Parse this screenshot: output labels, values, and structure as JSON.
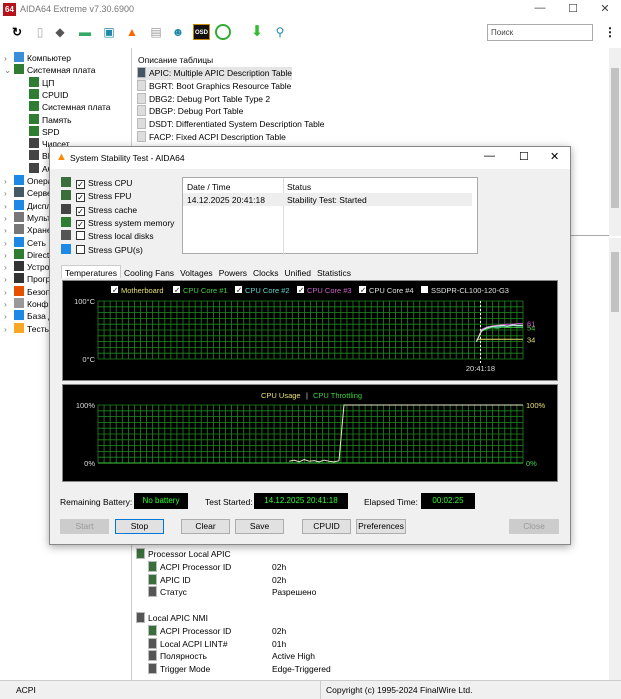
{
  "app": {
    "title": "AIDA64 Extreme v7.30.6900",
    "logo": "64"
  },
  "toolbar": {
    "search_placeholder": "Поиск",
    "icons": [
      "refresh-icon",
      "report-icon",
      "motherboard-icon",
      "memory-icon",
      "network-icon",
      "flame-icon",
      "tools-icon",
      "user-icon",
      "osd-icon",
      "gauge-icon",
      "download-icon",
      "search-icon"
    ],
    "osd": "OSD"
  },
  "tree": [
    {
      "label": "Компьютер",
      "level": 0,
      "expander": ">"
    },
    {
      "label": "Системная плата",
      "level": 0,
      "expander": "v"
    },
    {
      "label": "ЦП",
      "level": 1
    },
    {
      "label": "CPUID",
      "level": 1
    },
    {
      "label": "Системная плата",
      "level": 1
    },
    {
      "label": "Память",
      "level": 1
    },
    {
      "label": "SPD",
      "level": 1
    },
    {
      "label": "Чипсет",
      "level": 1
    },
    {
      "label": "BIOS",
      "level": 1
    },
    {
      "label": "ACPI",
      "level": 1
    },
    {
      "label": "Операционная система",
      "level": 0,
      "expander": ">"
    },
    {
      "label": "Сервер",
      "level": 0,
      "expander": ">"
    },
    {
      "label": "Дисплей",
      "level": 0,
      "expander": ">"
    },
    {
      "label": "Мультимедиа",
      "level": 0,
      "expander": ">"
    },
    {
      "label": "Хранение данных",
      "level": 0,
      "expander": ">"
    },
    {
      "label": "Сеть",
      "level": 0,
      "expander": ">"
    },
    {
      "label": "DirectX",
      "level": 0,
      "expander": ">"
    },
    {
      "label": "Устройства",
      "level": 0,
      "expander": ">"
    },
    {
      "label": "Программы",
      "level": 0,
      "expander": ">"
    },
    {
      "label": "Безопасность",
      "level": 0,
      "expander": ">"
    },
    {
      "label": "Конфигурация",
      "level": 0,
      "expander": ">"
    },
    {
      "label": "База данных",
      "level": 0,
      "expander": ">"
    },
    {
      "label": "Тесты",
      "level": 0,
      "expander": ">"
    }
  ],
  "acpi_tables": {
    "header": "Описание таблицы",
    "rows": [
      "APIC: Multiple APIC Description Table",
      "BGRT: Boot Graphics Resource Table",
      "DBG2: Debug Port Table Type 2",
      "DBGP: Debug Port Table",
      "DSDT: Differentiated System Description Table",
      "FACP: Fixed ACPI Description Table"
    ]
  },
  "details": [
    {
      "label": "Processor Local APIC",
      "value": "",
      "indent": 0
    },
    {
      "label": "ACPI Processor ID",
      "value": "02h",
      "indent": 1
    },
    {
      "label": "APIC ID",
      "value": "02h",
      "indent": 1
    },
    {
      "label": "Статус",
      "value": "Разрешено",
      "indent": 1
    },
    {
      "label": "",
      "value": "",
      "indent": 0
    },
    {
      "label": "Local APIC NMI",
      "value": "",
      "indent": 0
    },
    {
      "label": "ACPI Processor ID",
      "value": "02h",
      "indent": 1
    },
    {
      "label": "Local ACPI LINT#",
      "value": "01h",
      "indent": 1
    },
    {
      "label": "Полярность",
      "value": "Active High",
      "indent": 1
    },
    {
      "label": "Trigger Mode",
      "value": "Edge-Triggered",
      "indent": 1
    }
  ],
  "status": {
    "left": "ACPI",
    "right": "Copyright (c) 1995-2024 FinalWire Ltd."
  },
  "dialog": {
    "title": "System Stability Test - AIDA64",
    "stress": [
      {
        "label": "Stress CPU",
        "checked": true
      },
      {
        "label": "Stress FPU",
        "checked": true
      },
      {
        "label": "Stress cache",
        "checked": true
      },
      {
        "label": "Stress system memory",
        "checked": true
      },
      {
        "label": "Stress local disks",
        "checked": false
      },
      {
        "label": "Stress GPU(s)",
        "checked": false
      }
    ],
    "log": {
      "headers": [
        "Date / Time",
        "Status"
      ],
      "rows": [
        [
          "14.12.2025 20:41:18",
          "Stability Test: Started"
        ]
      ]
    },
    "tabs": [
      "Temperatures",
      "Cooling Fans",
      "Voltages",
      "Powers",
      "Clocks",
      "Unified",
      "Statistics"
    ],
    "active_tab": "Temperatures",
    "battery_label": "Remaining Battery:",
    "battery_value": "No battery",
    "started_label": "Test Started:",
    "started_value": "14.12.2025 20:41:18",
    "elapsed_label": "Elapsed Time:",
    "elapsed_value": "00:02:25",
    "buttons": {
      "start": "Start",
      "stop": "Stop",
      "clear": "Clear",
      "save": "Save",
      "cpuid": "CPUID",
      "preferences": "Preferences",
      "close": "Close"
    }
  },
  "chart_data": [
    {
      "type": "line",
      "title": "Temperatures",
      "ylim": [
        0,
        100
      ],
      "ytick_top": "100°C",
      "ytick_bottom": "0°C",
      "xtick": "20:41:18",
      "legend": [
        {
          "name": "Motherboard",
          "color": "#e8e070",
          "checked": true
        },
        {
          "name": "CPU Core #1",
          "color": "#40d040",
          "checked": true
        },
        {
          "name": "CPU Core #2",
          "color": "#60d0d0",
          "checked": true
        },
        {
          "name": "CPU Core #3",
          "color": "#d060d0",
          "checked": true
        },
        {
          "name": "CPU Core #4",
          "color": "#e0e0e0",
          "checked": true
        },
        {
          "name": "SSDPR-CL100-120-G3",
          "color": "#e0e0e0",
          "checked": false
        }
      ],
      "series": [
        {
          "name": "Motherboard",
          "values": [
            34,
            34,
            34,
            34,
            34,
            34,
            34,
            34,
            34,
            34
          ],
          "end_label": "34"
        },
        {
          "name": "CPU Core #1",
          "values": [
            30,
            48,
            52,
            54,
            53,
            55,
            54,
            55,
            54,
            54
          ],
          "end_label": "54"
        },
        {
          "name": "CPU Core #2",
          "values": [
            30,
            50,
            53,
            56,
            55,
            57,
            56,
            58,
            57,
            57
          ]
        },
        {
          "name": "CPU Core #3",
          "values": [
            30,
            51,
            55,
            57,
            58,
            59,
            60,
            60,
            61,
            61
          ],
          "end_label": "61"
        },
        {
          "name": "CPU Core #4",
          "values": [
            30,
            49,
            54,
            56,
            57,
            58,
            57,
            59,
            58,
            58
          ]
        }
      ]
    },
    {
      "type": "line",
      "title": "CPU Usage | CPU Throttling",
      "legend": [
        {
          "name": "CPU Usage",
          "color": "#e8e070"
        },
        {
          "name": "CPU Throttling",
          "color": "#40d040"
        }
      ],
      "ylim": [
        0,
        100
      ],
      "ytick_top": "100%",
      "ytick_bottom": "0%",
      "right_top": "100%",
      "right_bottom": "0%",
      "series": [
        {
          "name": "CPU Usage",
          "x_start_fraction": 0.45,
          "values": [
            3,
            5,
            2,
            6,
            3,
            4,
            2,
            5,
            3,
            2,
            4,
            100,
            100,
            100,
            100,
            100,
            100,
            100,
            100,
            100,
            100,
            100,
            100,
            100,
            100,
            100,
            100,
            100,
            100,
            100,
            100,
            100,
            100,
            100,
            100,
            100,
            100,
            100,
            100,
            100,
            100,
            100,
            100,
            100,
            100,
            100,
            100,
            100
          ]
        },
        {
          "name": "CPU Throttling",
          "values": [
            0,
            0
          ]
        }
      ]
    }
  ]
}
